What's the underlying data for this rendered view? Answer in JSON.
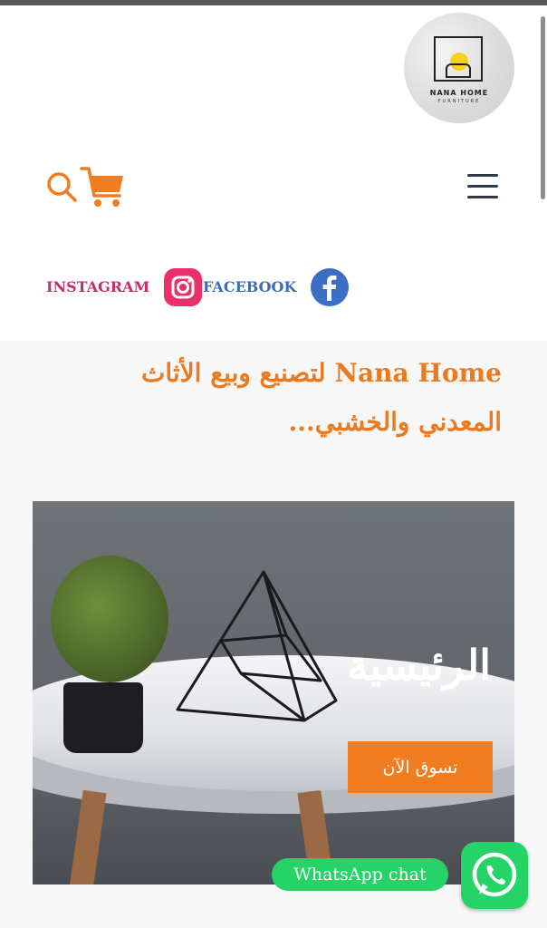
{
  "brand": {
    "logo_line1": "NANA HOME",
    "logo_line2": "FURNITURE"
  },
  "header": {
    "icons": [
      "search-icon",
      "cart-icon",
      "menu-icon"
    ],
    "accent_color": "#f07d1f"
  },
  "social": {
    "instagram_label": "INSTAGRAM",
    "facebook_label": "FACEBOOK",
    "instagram_color": "#e9306b",
    "facebook_color": "#3a6fc4"
  },
  "main": {
    "headline": "Nana Home لتصنيع وبيع الأثاث المعدني والخشبي...",
    "hero_title": "الرئيسية",
    "cta_label": "تسوق الآن"
  },
  "whatsapp": {
    "label": "WhatsApp chat",
    "color": "#25d366"
  }
}
